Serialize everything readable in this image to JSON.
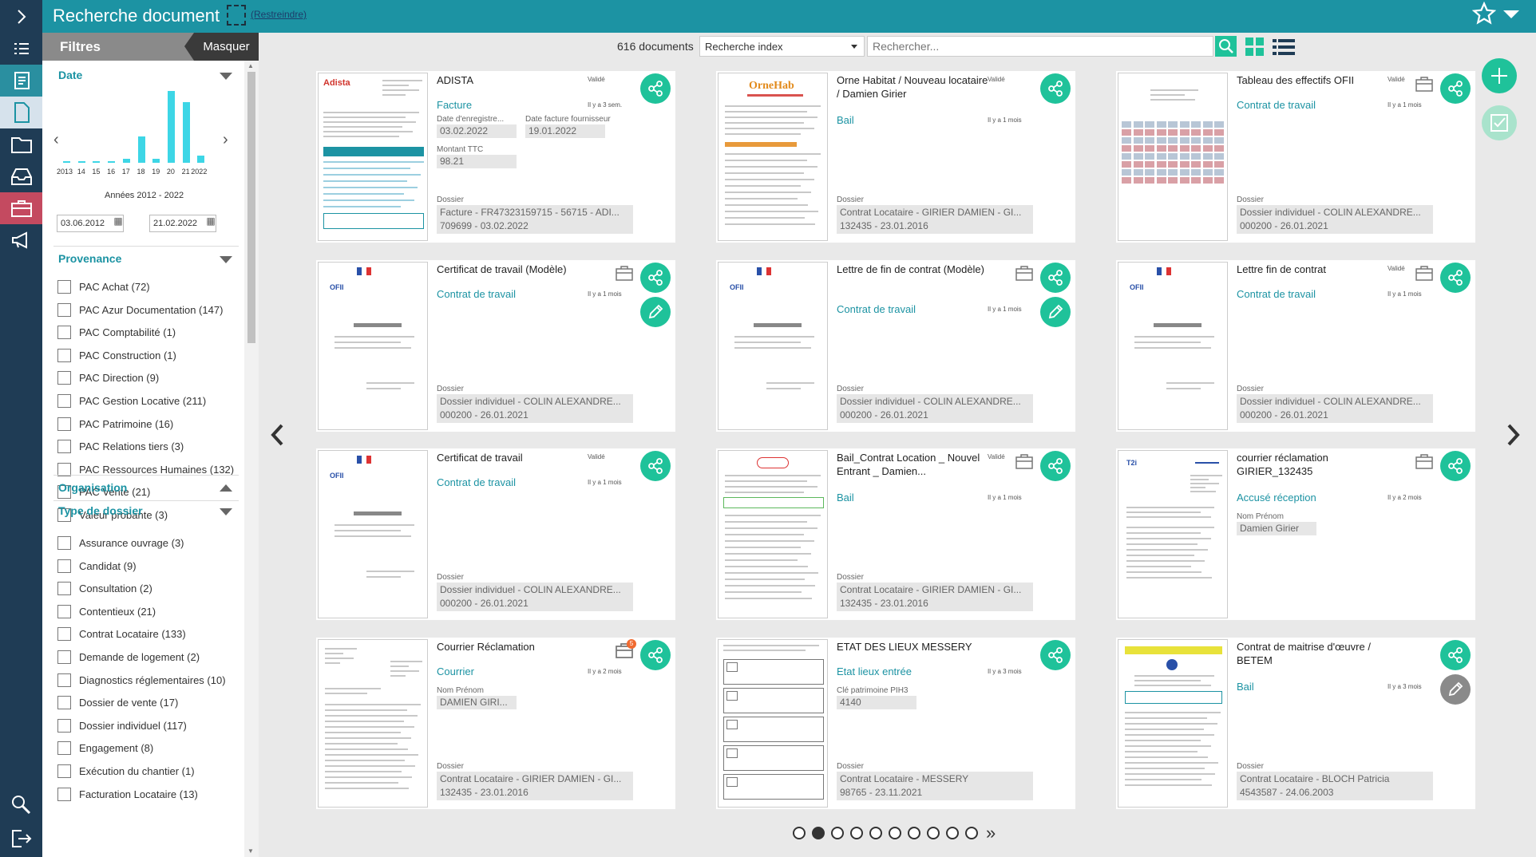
{
  "header": {
    "title": "Recherche document",
    "restrict_label": "(Restreindre)"
  },
  "filters": {
    "title": "Filtres",
    "hide_label": "Masquer",
    "date": {
      "title": "Date",
      "histogram": {
        "years": [
          "2013",
          "14",
          "15",
          "16",
          "17",
          "18",
          "19",
          "20",
          "21",
          "2022"
        ],
        "values": [
          0,
          0,
          0,
          0,
          1,
          7,
          1,
          19,
          16,
          2
        ]
      },
      "range_label": "Années 2012 - 2022",
      "from": "03.06.2012",
      "to": "21.02.2022"
    },
    "provenance": {
      "title": "Provenance",
      "items": [
        "PAC Achat (72)",
        "PAC Azur Documentation (147)",
        "PAC Comptabilité (1)",
        "PAC Construction (1)",
        "PAC Direction (9)",
        "PAC Gestion Locative (211)",
        "PAC Patrimoine (16)",
        "PAC Relations tiers (3)",
        "PAC Ressources Humaines (132)",
        "PAC Vente (21)",
        "Valeur probante (3)"
      ]
    },
    "organisation": {
      "title": "Organisation"
    },
    "type_dossier": {
      "title": "Type de dossier",
      "items": [
        "Assurance ouvrage (3)",
        "Candidat (9)",
        "Consultation (2)",
        "Contentieux (21)",
        "Contrat Locataire (133)",
        "Demande de logement (2)",
        "Diagnostics réglementaires (10)",
        "Dossier de vente (17)",
        "Dossier individuel (117)",
        "Engagement (8)",
        "Exécution du chantier (1)",
        "Facturation Locataire (13)"
      ]
    }
  },
  "toolbar": {
    "count": "616 documents",
    "index_select": "Recherche index",
    "search_placeholder": "Rechercher..."
  },
  "cards": [
    {
      "title": "ADISTA",
      "type": "Facture",
      "status": "Validé",
      "age": "Il y a 3 sem.",
      "fields": [
        {
          "label": "Date d'enregistre...",
          "value": "03.02.2022"
        },
        {
          "label": "Date facture fournisseur",
          "value": "19.01.2022"
        },
        {
          "label": "Montant TTC",
          "value": "98.21"
        }
      ],
      "dossier_label": "Dossier",
      "dossier_line1": "Facture - FR47323159715 - 56715 - ADI...",
      "dossier_line2": "709699 - 03.02.2022"
    },
    {
      "title": "Orne Habitat / Nouveau locataire / Damien Girier",
      "type": "Bail",
      "status": "Validé",
      "age": "Il y a 1 mois",
      "dossier_label": "Dossier",
      "dossier_line1": "Contrat Locataire - GIRIER DAMIEN - GI...",
      "dossier_line2": "132435 - 23.01.2016"
    },
    {
      "title": "Tableau des effectifs OFII",
      "type": "Contrat de travail",
      "status": "Validé",
      "age": "Il y a 1 mois",
      "dossier_label": "Dossier",
      "dossier_line1": "Dossier individuel - COLIN ALEXANDRE...",
      "dossier_line2": "000200 - 26.01.2021"
    },
    {
      "title": "Certificat de travail (Modèle)",
      "type": "Contrat de travail",
      "age": "Il y a 1 mois",
      "dossier_label": "Dossier",
      "dossier_line1": "Dossier individuel - COLIN ALEXANDRE...",
      "dossier_line2": "000200 - 26.01.2021"
    },
    {
      "title": "Lettre de fin de contrat (Modèle)",
      "type": "Contrat de travail",
      "age": "Il y a 1 mois",
      "dossier_label": "Dossier",
      "dossier_line1": "Dossier individuel - COLIN ALEXANDRE...",
      "dossier_line2": "000200 - 26.01.2021"
    },
    {
      "title": "Lettre fin de contrat",
      "type": "Contrat de travail",
      "status": "Validé",
      "age": "Il y a 1 mois",
      "dossier_label": "Dossier",
      "dossier_line1": "Dossier individuel - COLIN ALEXANDRE...",
      "dossier_line2": "000200 - 26.01.2021"
    },
    {
      "title": "Certificat de travail",
      "type": "Contrat de travail",
      "status": "Validé",
      "age": "Il y a 1 mois",
      "dossier_label": "Dossier",
      "dossier_line1": "Dossier individuel - COLIN ALEXANDRE...",
      "dossier_line2": "000200 - 26.01.2021"
    },
    {
      "title": "Bail_Contrat Location _ Nouvel Entrant _ Damien...",
      "type": "Bail",
      "status": "Validé",
      "age": "Il y a 1 mois",
      "dossier_label": "Dossier",
      "dossier_line1": "Contrat Locataire - GIRIER DAMIEN - GI...",
      "dossier_line2": "132435 - 23.01.2016"
    },
    {
      "title": "courrier réclamation GIRIER_132435",
      "type": "Accusé réception",
      "age": "Il y a 2 mois",
      "fields": [
        {
          "label": "Nom Prénom",
          "value": "Damien Girier"
        }
      ]
    },
    {
      "title": "Courrier Réclamation",
      "type": "Courrier",
      "age": "Il y a 2 mois",
      "badge": "5",
      "fields": [
        {
          "label": "Nom Prénom",
          "value": "DAMIEN GIRI..."
        }
      ],
      "dossier_label": "Dossier",
      "dossier_line1": "Contrat Locataire - GIRIER DAMIEN - GI...",
      "dossier_line2": "132435 - 23.01.2016"
    },
    {
      "title": "ETAT DES LIEUX MESSERY",
      "type": "Etat lieux entrée",
      "age": "Il y a 3 mois",
      "fields": [
        {
          "label": "Clé patrimoine PIH3",
          "value": "4140"
        }
      ],
      "dossier_label": "Dossier",
      "dossier_line1": "Contrat Locataire - MESSERY",
      "dossier_line2": "98765 - 23.11.2021"
    },
    {
      "title": "Contrat de maitrise d'œuvre / BETEM",
      "type": "Bail",
      "age": "Il y a 3 mois",
      "dossier_label": "Dossier",
      "dossier_line1": "Contrat Locataire - BLOCH Patricia",
      "dossier_line2": "4543587 - 24.06.2003"
    }
  ],
  "thumbnail_logos": {
    "adista": "Adista",
    "orne": "OrneHab",
    "ofii": "OFII",
    "t2i": "T2i"
  },
  "colors": {
    "teal": "#1c93a3",
    "green": "#1fc29a",
    "navy": "#1f3c55"
  }
}
